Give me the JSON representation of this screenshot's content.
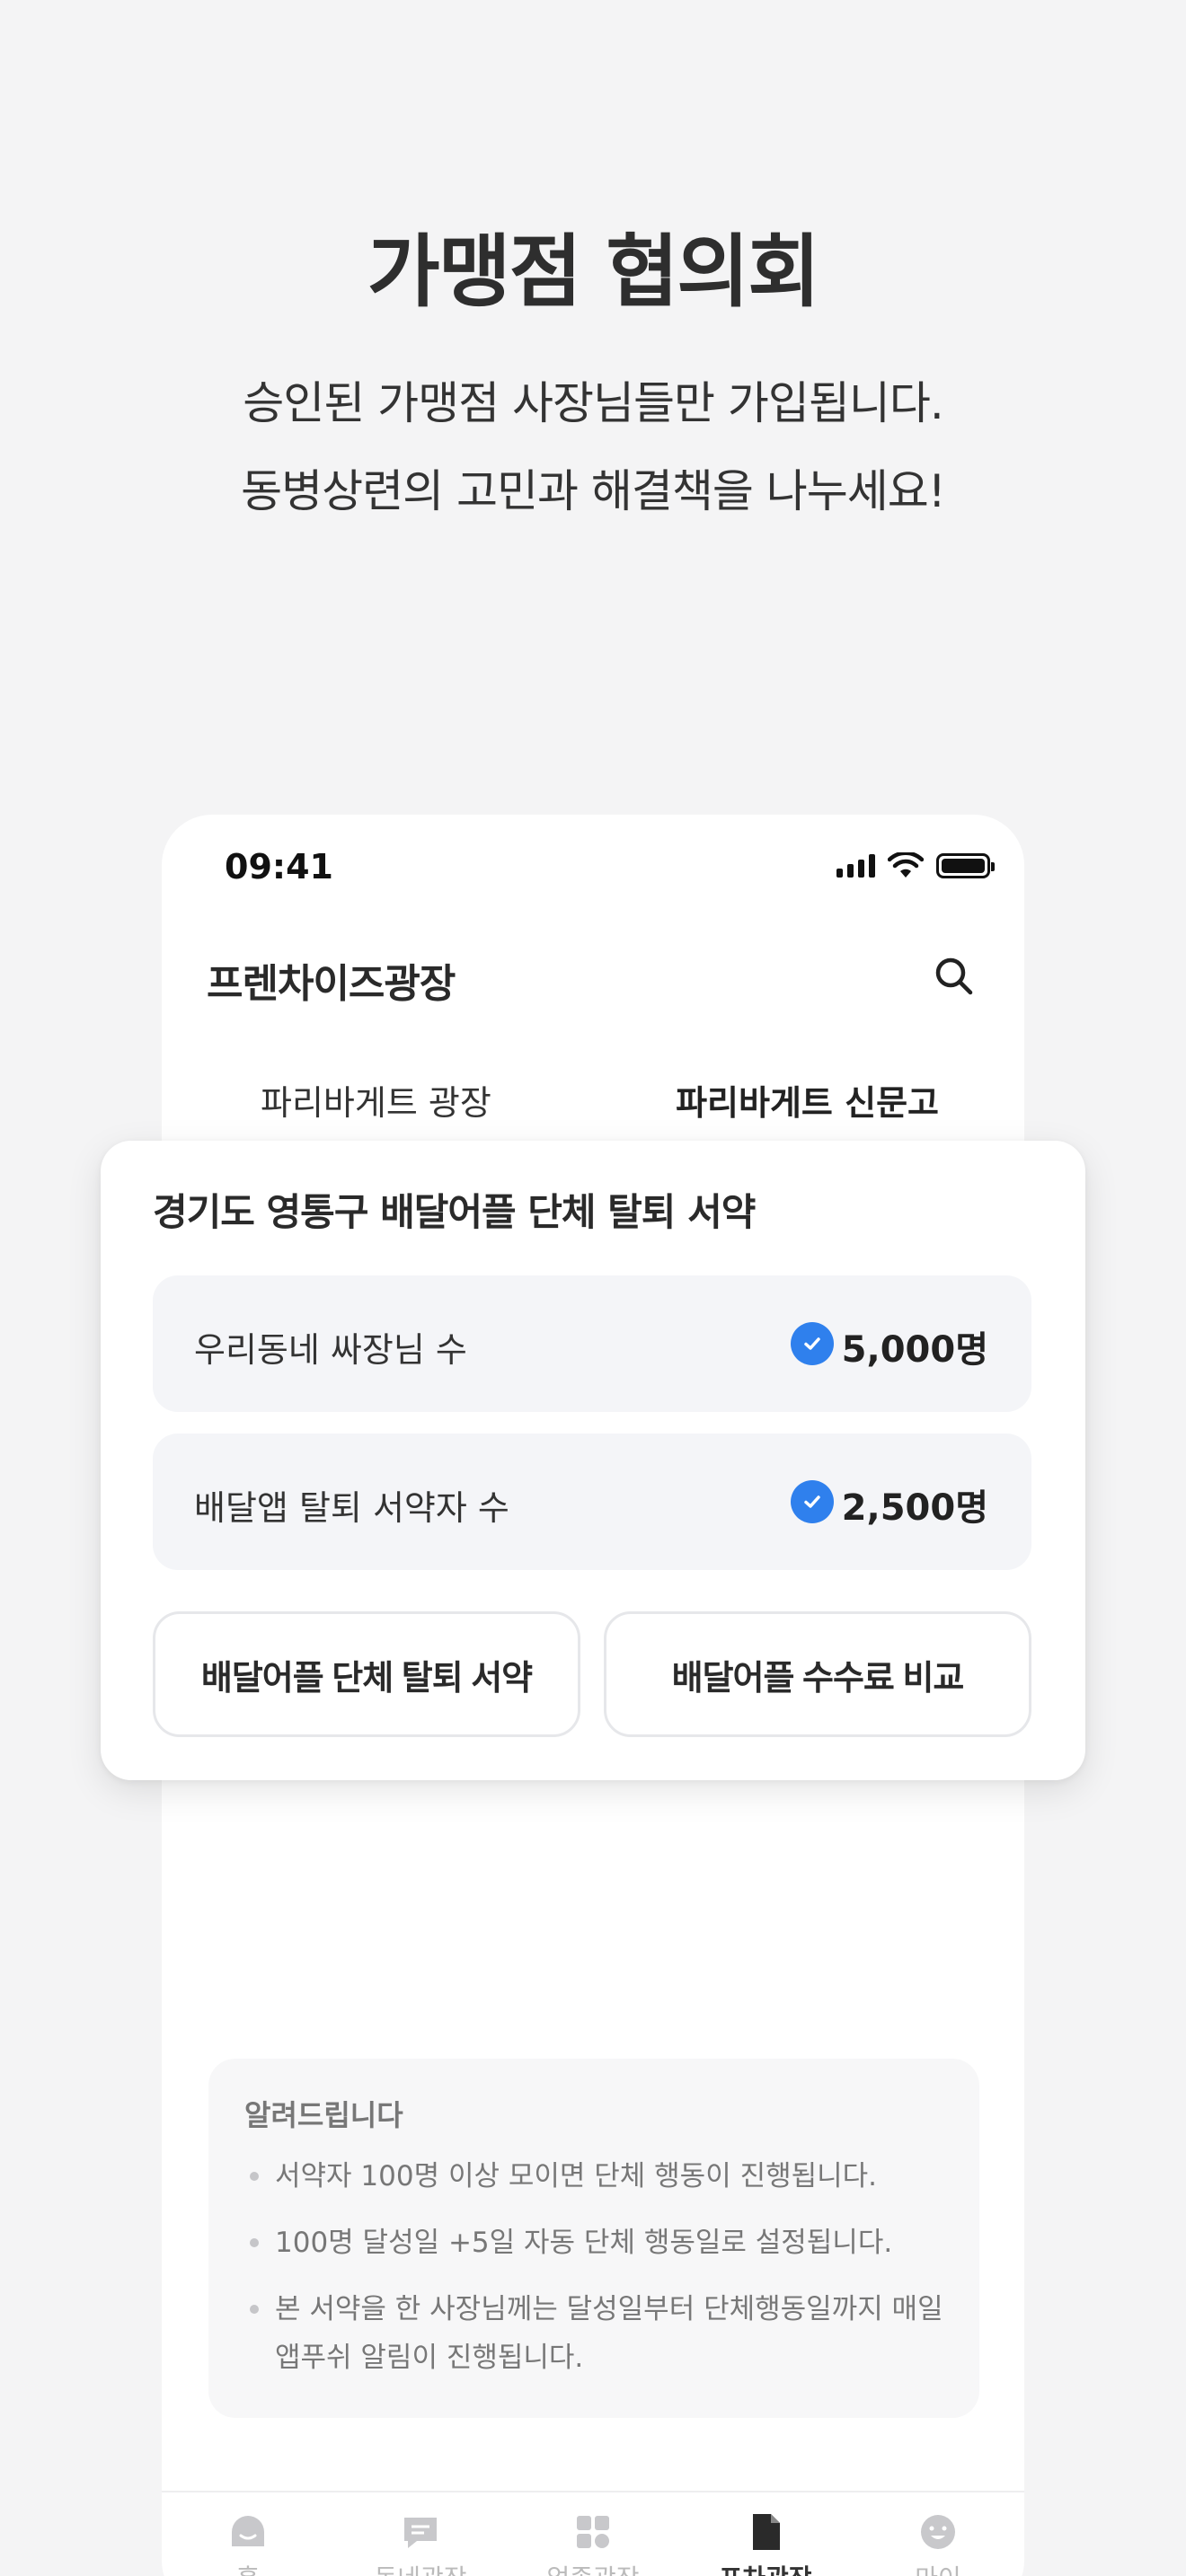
{
  "hero": {
    "title": "가맹점 협의회",
    "subtitle_line1": "승인된 가맹점 사장님들만 가입됩니다.",
    "subtitle_line2": "동병상련의 고민과 해결책을 나누세요!"
  },
  "status_bar": {
    "time": "09:41"
  },
  "app": {
    "title": "프렌차이즈광장",
    "search_icon": "search-icon",
    "tabs": [
      {
        "label": "파리바게트 광장",
        "active": false
      },
      {
        "label": "파리바게트 신문고",
        "active": true
      }
    ]
  },
  "card": {
    "title": "경기도 영통구 배달어플 단체 탈퇴 서약",
    "stats": [
      {
        "label": "우리동네 싸장님 수",
        "value": "5,000명"
      },
      {
        "label": "배달앱 탈퇴 서약자 수",
        "value": "2,500명"
      }
    ],
    "buttons": [
      {
        "label": "배달어플 단체 탈퇴 서약"
      },
      {
        "label": "배달어플 수수료 비교"
      }
    ],
    "accent": "#2f80ed"
  },
  "notice": {
    "title": "알려드립니다",
    "items": [
      "서약자 100명 이상 모이면 단체 행동이 진행됩니다.",
      "100명 달성일 +5일 자동 단체 행동일로 설정됩니다.",
      "본 서약을 한 사장님께는 달성일부터 단체행동일까지 매일 앱푸쉬 알림이 진행됩니다."
    ]
  },
  "bottom_nav": [
    {
      "icon": "home-icon",
      "label": "홈"
    },
    {
      "icon": "chat-icon",
      "label": "동네광장"
    },
    {
      "icon": "grid-icon",
      "label": "업종광장"
    },
    {
      "icon": "document-icon",
      "label": "프차광장",
      "active": true
    },
    {
      "icon": "smile-icon",
      "label": "마이"
    }
  ]
}
